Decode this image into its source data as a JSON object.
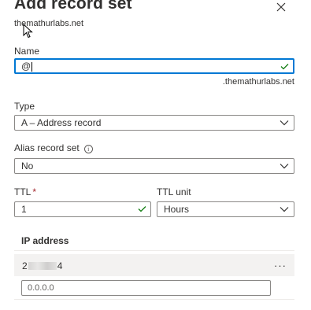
{
  "panel": {
    "title": "Add record set",
    "subtitle": "themathurlabs.net"
  },
  "name": {
    "label": "Name",
    "value": "@",
    "suffix": ".themathurlabs.net"
  },
  "type": {
    "label": "Type",
    "value": "A – Address record"
  },
  "alias": {
    "label": "Alias record set",
    "info_glyph": "i",
    "value": "No"
  },
  "ttl": {
    "label": "TTL",
    "required_mark": "*",
    "value": "1"
  },
  "ttl_unit": {
    "label": "TTL unit",
    "value": "Hours"
  },
  "ip": {
    "header": "IP address",
    "row_prefix": "2",
    "row_suffix": "4",
    "more_glyph": "···",
    "placeholder": "0.0.0.0"
  },
  "colors": {
    "accent": "#0078d4",
    "check": "#107c10",
    "required": "#a4262c"
  },
  "icons": {
    "close": "close-icon",
    "check": "checkmark-icon",
    "chevron": "chevron-down-icon",
    "info": "info-icon",
    "more": "more-icon",
    "cursor": "mouse-pointer-icon"
  }
}
